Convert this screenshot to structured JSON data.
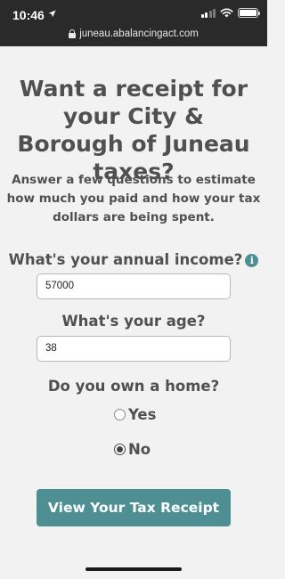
{
  "status_bar": {
    "time": "10:46",
    "url": "juneau.abalancingact.com"
  },
  "icons": {
    "location": "location-arrow-icon",
    "signal": "cellular-signal-icon",
    "wifi": "wifi-icon",
    "battery": "battery-icon",
    "lock": "lock-icon",
    "info": "info-icon"
  },
  "battery_level": 1.0,
  "colors": {
    "accent": "#4e8f94",
    "text": "#505050",
    "background": "#f2f2f2",
    "status_bar": "#2a2a2a"
  },
  "form": {
    "heading": "Want a receipt for your City & Borough of Juneau taxes?",
    "intro": "Answer a few questions to estimate how much you paid and how your tax dollars are being spent.",
    "income_label": "What's your annual income?",
    "info_glyph": "i",
    "income_value": "57000",
    "age_label": "What's your age?",
    "age_value": "38",
    "home_label": "Do you own a home?",
    "options": [
      {
        "label": "Yes",
        "checked": false
      },
      {
        "label": "No",
        "checked": true
      }
    ],
    "submit_label": "View Your Tax Receipt"
  }
}
